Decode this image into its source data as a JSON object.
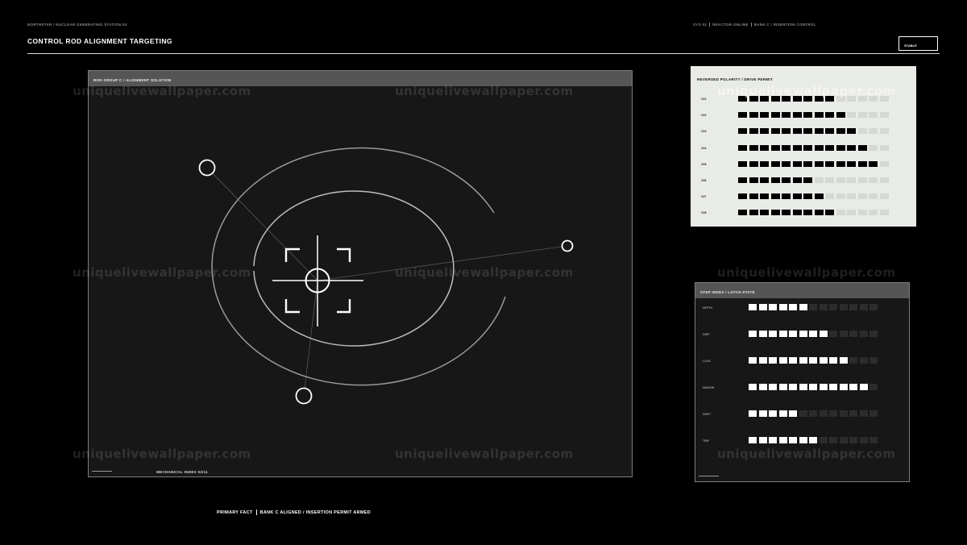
{
  "header": {
    "breadcrumb": "NORTHSTAR / NUCLEAR GENERATING STATION 04",
    "title": "CONTROL ROD ALIGNMENT TARGETING",
    "status": [
      "SYS 02",
      "REACTOR ONLINE",
      "BANK C / INSERTION CONTROL"
    ],
    "stable_label": "STABLE"
  },
  "main_panel": {
    "header": "ROD GROUP C / ALIGNMENT SOLUTION",
    "footer": "MECHANICAL INDEX 02/11"
  },
  "polarity_panel": {
    "title": "REVERSED POLARITY / DRIVE PERMIT",
    "total_cells": 14,
    "rows": [
      {
        "label": "C01",
        "value": 9
      },
      {
        "label": "C02",
        "value": 10
      },
      {
        "label": "C03",
        "value": 11
      },
      {
        "label": "C04",
        "value": 12
      },
      {
        "label": "C05",
        "value": 13
      },
      {
        "label": "C06",
        "value": 7
      },
      {
        "label": "C07",
        "value": 8
      },
      {
        "label": "C08",
        "value": 9
      }
    ]
  },
  "step_panel": {
    "title": "STEP INDEX / LATCH STATE",
    "total_cells": 13,
    "rows": [
      {
        "label": "DEPTH",
        "value": 6
      },
      {
        "label": "GRIP",
        "value": 8
      },
      {
        "label": "LOCK",
        "value": 10
      },
      {
        "label": "MARGIN",
        "value": 12
      },
      {
        "label": "DRIFT",
        "value": 5
      },
      {
        "label": "TRIP",
        "value": 7
      }
    ]
  },
  "footer": {
    "primary": "PRIMARY FACT",
    "detail": "BANK C ALIGNED / INSERTION PERMIT ARMED"
  },
  "watermark": "uniquelivewallpaper.com",
  "colors": {
    "background": "#000000",
    "panel_dark": "#161716",
    "panel_header": "#545554",
    "panel_light": "#e9ebe7",
    "cell_on_dark": "#ffffff",
    "cell_off_dark": "#2b2c2b",
    "cell_on_light": "#000000",
    "cell_off_light": "#d6d8d4"
  },
  "icons": [
    "crosshair-icon",
    "target-marker-icon"
  ]
}
